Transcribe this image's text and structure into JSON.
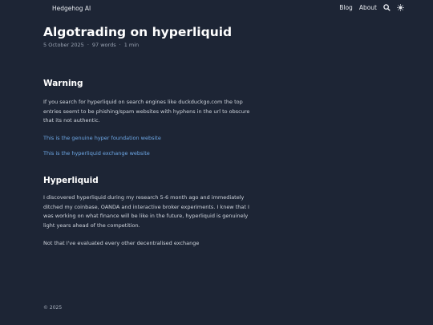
{
  "header": {
    "site_title": "Hedgehog AI",
    "nav": {
      "blog": "Blog",
      "about": "About"
    },
    "icons": {
      "search": "search-icon",
      "theme": "theme-toggle-icon"
    }
  },
  "post": {
    "title": "Algotrading on hyperliquid",
    "date": "5 October 2025",
    "words": "97 words",
    "read_time": "1 min",
    "sections": [
      {
        "heading": "Warning",
        "paragraph": "If you search for hyperliquid on search engines like duckduckgo.com the top entries seemt to be phishing/spam websites with hyphens in the url to obscure that its not authentic.",
        "links": [
          "This is the genuine hyper foundation website",
          "This is the hyperliquid exchange website"
        ]
      },
      {
        "heading": "Hyperliquid",
        "paragraph": "I discovered hyperliquid during my research 5-6 month ago and immediately ditched my coinbase, OANDA and interactive broker experiments. I knew that I was working on what finance will be like in the future, hyperliquid is genuinely light years ahead of the competition.",
        "paragraph2": "Not that I've evaluated every other decentralised exchange"
      }
    ]
  },
  "footer": {
    "copyright": "© 2025"
  },
  "colors": {
    "background": "#1d2535",
    "link": "#6ea8e6",
    "text": "#d0d5dd"
  }
}
